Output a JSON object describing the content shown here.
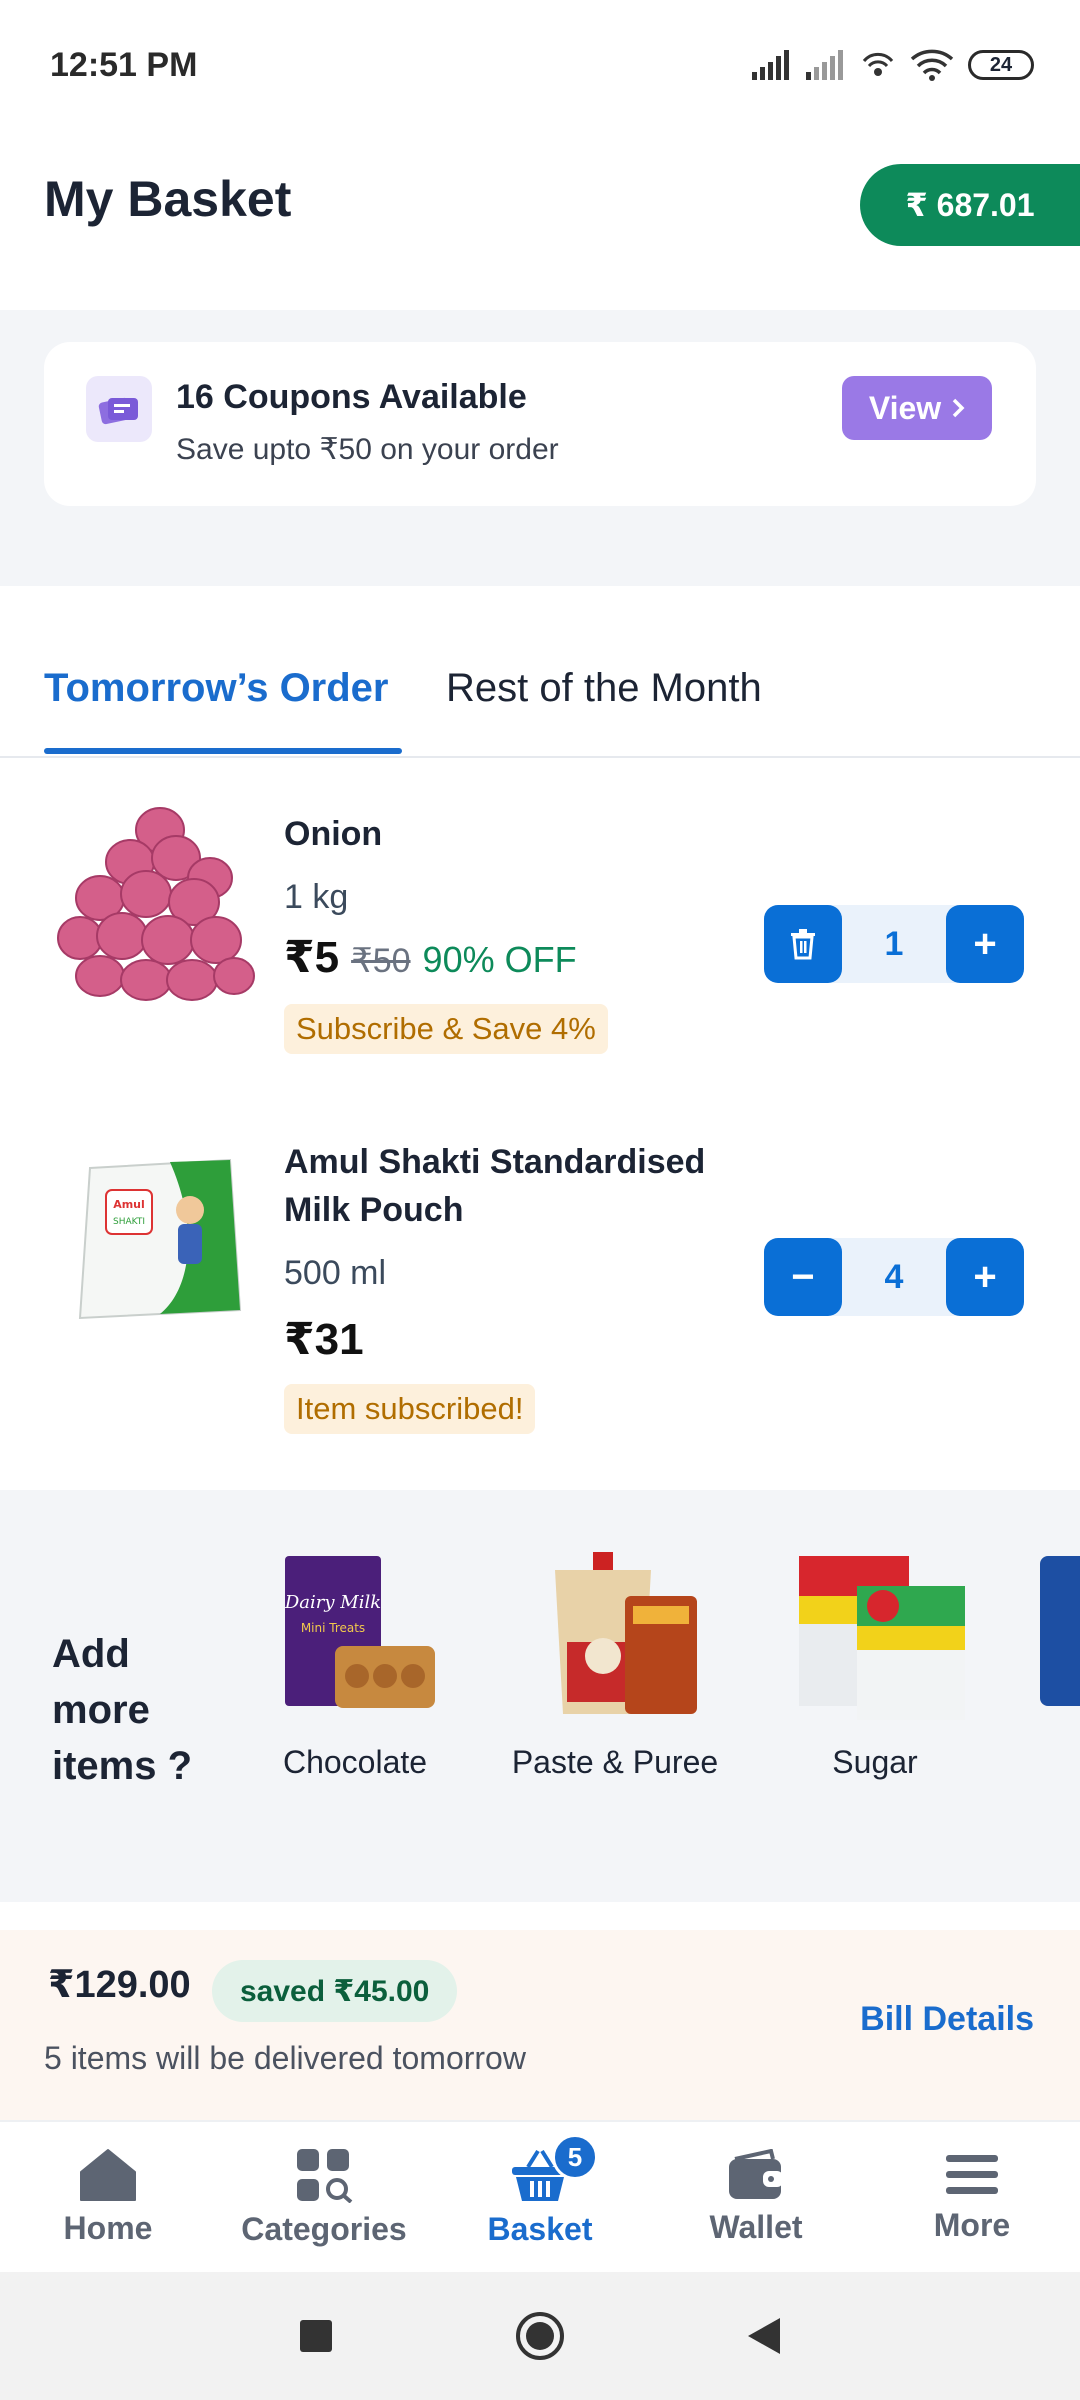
{
  "status_bar": {
    "time": "12:51 PM",
    "battery": "24"
  },
  "header": {
    "title": "My Basket",
    "wallet_amount": "₹ 687.01"
  },
  "coupons": {
    "title": "16 Coupons Available",
    "subtitle": "Save upto ₹50 on your order",
    "view_label": "View"
  },
  "tabs": [
    {
      "label": "Tomorrow’s Order",
      "active": true
    },
    {
      "label": "Rest of the Month",
      "active": false
    }
  ],
  "items": [
    {
      "name": "Onion",
      "quantity_label": "1 kg",
      "price": "₹5",
      "mrp": "₹50",
      "discount": "90% OFF",
      "tag": "Subscribe & Save 4%",
      "count": "1"
    },
    {
      "name": "Amul Shakti Standardised Milk Pouch",
      "quantity_label": "500 ml",
      "price": "₹31",
      "tag": "Item subscribed!",
      "count": "4"
    }
  ],
  "add_more": {
    "title": "Add more items ?",
    "categories": [
      {
        "label": "Chocolate"
      },
      {
        "label": "Paste & Puree"
      },
      {
        "label": "Sugar"
      }
    ]
  },
  "summary": {
    "total": "₹129.00",
    "saved": "saved ₹45.00",
    "note": "5 items will be delivered tomorrow",
    "bill_link": "Bill Details"
  },
  "bottom_nav": [
    {
      "label": "Home",
      "icon": "home-icon"
    },
    {
      "label": "Categories",
      "icon": "categories-icon"
    },
    {
      "label": "Basket",
      "icon": "basket-icon",
      "active": true,
      "badge": "5"
    },
    {
      "label": "Wallet",
      "icon": "wallet-icon"
    },
    {
      "label": "More",
      "icon": "menu-icon"
    }
  ],
  "colors": {
    "primary": "#1a6ccd",
    "wallet_green": "#0d8a5a",
    "coupon_purple": "#9a79e6"
  }
}
